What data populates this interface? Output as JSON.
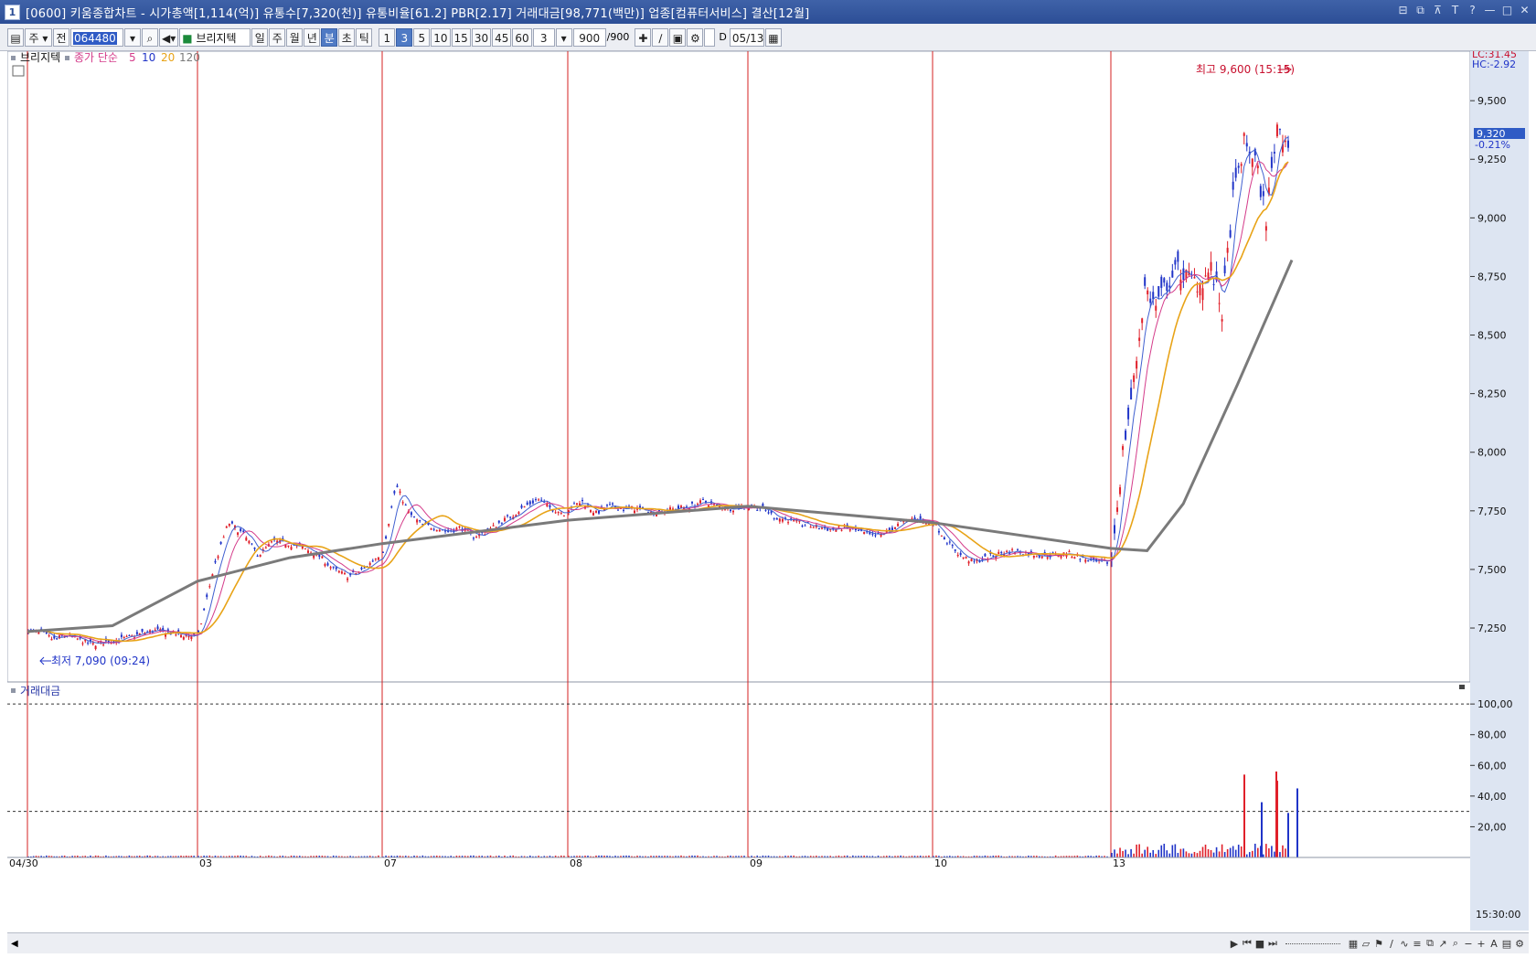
{
  "window": {
    "badge": "1",
    "title": "[0600] 키움종합차트 - 시가총액[1,114(억)] 유통수[7,320(천)] 유통비율[61.2] PBR[2.17] 거래대금[98,771(백만)] 업종[컴퓨터서비스] 결산[12월]",
    "controls": [
      "⊟",
      "⧉",
      "⊼",
      "T",
      "?",
      "—",
      "□",
      "✕"
    ]
  },
  "toolbar": {
    "period_select": "주",
    "market_select": "전",
    "stock_code": "064480",
    "stock_name": "브리지텍",
    "period_buttons": [
      "일",
      "주",
      "월",
      "년",
      "분",
      "초",
      "틱"
    ],
    "active_period": "분",
    "minute_buttons": [
      "1",
      "3",
      "5",
      "10",
      "15",
      "30",
      "45",
      "60"
    ],
    "active_minute": "3",
    "custom_minute": "3",
    "count_value": "900",
    "count_total": "/900",
    "d_label": "D",
    "date_value": "05/13"
  },
  "legend": {
    "stock": "브리지텍",
    "price_label": "종가 단순",
    "ma_periods": [
      "5",
      "10",
      "20",
      "120"
    ],
    "volume_label": "거래대금"
  },
  "annotations": {
    "high": "최고 9,600 (15:15)",
    "low": "최저 7,090 (09:24)",
    "lc": "LC:31.45",
    "hc": "HC:-2.92",
    "last_price": "9,320",
    "last_change": "-0.21%",
    "time_label": "15:30:00"
  },
  "colors": {
    "up": "#e0202a",
    "down": "#2034c8",
    "ma5": "#4060d0",
    "ma10": "#d43b8a",
    "ma20": "#e8a317",
    "ma120": "#7a7a7a",
    "separator": "#d42020",
    "axis_bg": "#dde5f2",
    "title_bg": "#2c4e96"
  },
  "chart_data": {
    "type": "candlestick",
    "price_axis": {
      "ticks": [
        7250,
        7500,
        7750,
        8000,
        8250,
        8500,
        8750,
        9000,
        9250,
        9500
      ],
      "range": [
        7020,
        9680
      ]
    },
    "volume_axis": {
      "ticks": [
        "20,00",
        "40,00",
        "60,00",
        "80,00",
        "100,00"
      ],
      "range": [
        0,
        112
      ]
    },
    "date_labels": [
      "04/30",
      "03",
      "07",
      "08",
      "09",
      "10",
      "13"
    ],
    "day_closes": [
      [
        7240,
        7230,
        7200,
        7220,
        7200,
        7180,
        7190,
        7200,
        7210,
        7230,
        7240,
        7230,
        7220,
        7215
      ],
      [
        7220,
        7500,
        7700,
        7650,
        7560,
        7620,
        7610,
        7590,
        7560,
        7500,
        7470,
        7500,
        7560
      ],
      [
        7580,
        7860,
        7740,
        7690,
        7680,
        7660,
        7680,
        7640,
        7660,
        7700,
        7730,
        7770,
        7800,
        7760,
        7740
      ],
      [
        7760,
        7790,
        7740,
        7770,
        7760,
        7760,
        7740,
        7750,
        7760,
        7770,
        7790,
        7770,
        7760,
        7770
      ],
      [
        7770,
        7760,
        7720,
        7710,
        7690,
        7680,
        7670,
        7680,
        7660,
        7640,
        7660,
        7700,
        7720,
        7700
      ],
      [
        7700,
        7620,
        7560,
        7530,
        7550,
        7570,
        7580,
        7570,
        7560,
        7560,
        7570,
        7550,
        7530,
        7530
      ],
      [
        7550,
        8000,
        8300,
        8700,
        8620,
        8720,
        8780,
        8740,
        8720,
        8780,
        8600,
        9080,
        9320,
        9250,
        9000,
        9400,
        9320
      ]
    ],
    "ma120_line": [
      [
        0,
        7235
      ],
      [
        0.5,
        7260
      ],
      [
        1,
        7450
      ],
      [
        1.5,
        7550
      ],
      [
        2,
        7610
      ],
      [
        3,
        7710
      ],
      [
        4,
        7770
      ],
      [
        5,
        7700
      ],
      [
        6,
        7590
      ],
      [
        6.2,
        7580
      ],
      [
        6.4,
        7780
      ],
      [
        6.7,
        8290
      ],
      [
        7,
        8820
      ]
    ],
    "volume_spike_values": [
      54,
      36,
      50,
      29,
      56,
      45
    ]
  }
}
